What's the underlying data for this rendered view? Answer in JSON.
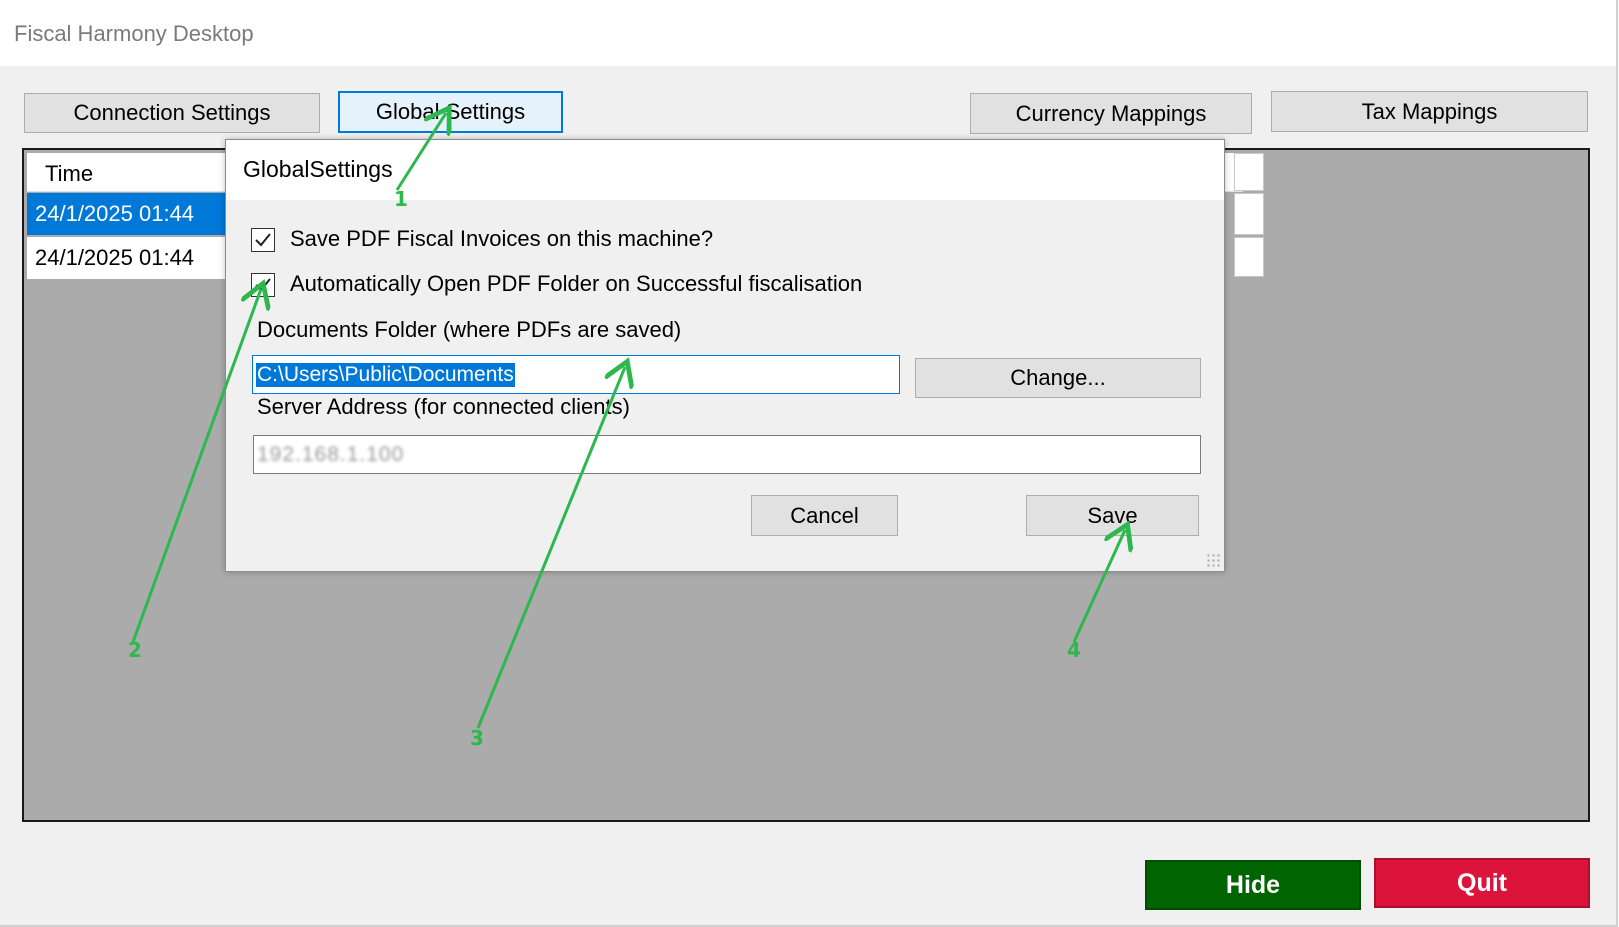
{
  "window": {
    "title": "Fiscal Harmony Desktop"
  },
  "tabs": {
    "connection_settings": "Connection Settings",
    "global_settings": "Global Settings",
    "currency_mappings": "Currency Mappings",
    "tax_mappings": "Tax Mappings"
  },
  "log": {
    "column_header": "Time",
    "rows": [
      {
        "time": "24/1/2025 01:44",
        "selected": true
      },
      {
        "time": "24/1/2025 01:44",
        "selected": false
      }
    ]
  },
  "dialog": {
    "title": "GlobalSettings",
    "save_pdf_checkbox": {
      "label": "Save PDF Fiscal Invoices on this machine?",
      "checked": true
    },
    "auto_open_checkbox": {
      "label": "Automatically Open PDF Folder on Successful fiscalisation",
      "checked": true
    },
    "documents_folder_label": "Documents Folder (where PDFs are saved)",
    "documents_folder_value": "C:\\Users\\Public\\Documents",
    "change_button": "Change...",
    "server_address_label": "Server Address (for connected clients)",
    "server_address_value": "192.168.1.100",
    "cancel_button": "Cancel",
    "save_button": "Save"
  },
  "footer": {
    "hide_button": "Hide",
    "quit_button": "Quit"
  },
  "annotations": {
    "step_1": "1",
    "step_2": "2",
    "step_3": "3",
    "step_4": "4",
    "arrow_color": "#2db84d"
  },
  "colors": {
    "hide_bg": "#006400",
    "quit_bg": "#dc143c",
    "selection": "#0078d7"
  }
}
